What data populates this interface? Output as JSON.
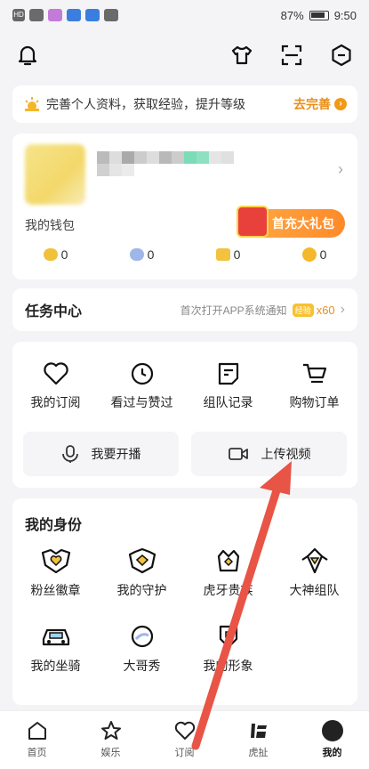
{
  "status": {
    "left_label": "HD",
    "battery": "87%",
    "time": "9:50"
  },
  "banner": {
    "text": "完善个人资料，获取经验，提升等级",
    "cta": "去完善"
  },
  "profile": {
    "wallet_label": "我的钱包",
    "gift_label": "首充大礼包",
    "coins": [
      {
        "value": "0",
        "color": "#f0c23a"
      },
      {
        "value": "0",
        "color": "#9fb6e8"
      },
      {
        "value": "0",
        "color": "#f3c23e"
      },
      {
        "value": "0",
        "color": "#f5b82d"
      }
    ]
  },
  "task": {
    "title": "任务中心",
    "subtitle": "首次打开APP系统通知",
    "xp_badge": "经验",
    "xp_count": "x60"
  },
  "shortcuts": {
    "items": [
      {
        "label": "我的订阅",
        "icon": "heart-icon"
      },
      {
        "label": "看过与赞过",
        "icon": "clock-icon"
      },
      {
        "label": "组队记录",
        "icon": "note-icon"
      },
      {
        "label": "购物订单",
        "icon": "cart-icon"
      }
    ],
    "broadcast": "我要开播",
    "upload": "上传视频"
  },
  "identity": {
    "title": "我的身份",
    "items": [
      {
        "label": "粉丝徽章",
        "icon": "fan-badge-icon"
      },
      {
        "label": "我的守护",
        "icon": "guard-icon"
      },
      {
        "label": "虎牙贵族",
        "icon": "crown-icon"
      },
      {
        "label": "大神组队",
        "icon": "diamond-icon"
      },
      {
        "label": "我的坐骑",
        "icon": "car-icon"
      },
      {
        "label": "大哥秀",
        "icon": "planet-icon"
      },
      {
        "label": "我的形象",
        "icon": "shield-icon"
      }
    ]
  },
  "nav": [
    {
      "label": "首页",
      "icon": "home-icon"
    },
    {
      "label": "娱乐",
      "icon": "star-icon"
    },
    {
      "label": "订阅",
      "icon": "heart-icon"
    },
    {
      "label": "虎扯",
      "icon": "huche-icon"
    },
    {
      "label": "我的",
      "icon": "avatar-icon"
    }
  ]
}
